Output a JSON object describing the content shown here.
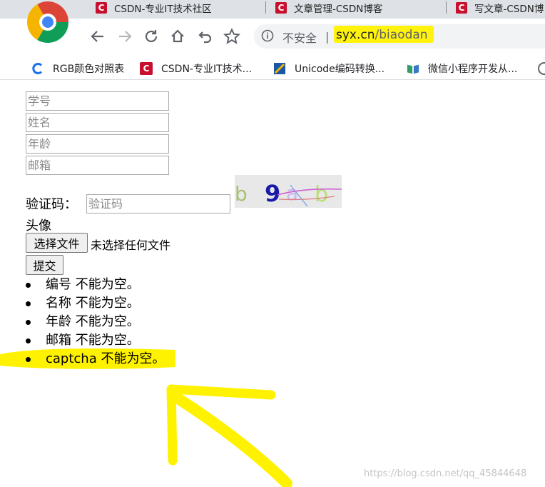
{
  "browser": {
    "tabs": [
      {
        "title": "CSDN-专业IT技术社区"
      },
      {
        "title": "文章管理-CSDN博客"
      },
      {
        "title": "写文章-CSDN博"
      }
    ],
    "omnibox": {
      "security_label": "不安全",
      "divider": "|",
      "url_host": "syx.cn",
      "url_path": "/biaodan"
    },
    "bookmarks": [
      {
        "label": "RGB颜色对照表",
        "icon": "rgb-c-icon"
      },
      {
        "label": "CSDN-专业IT技术...",
        "icon": "csdn-icon"
      },
      {
        "label": "Unicode编码转换...",
        "icon": "unicode-icon"
      },
      {
        "label": "微信小程序开发从...",
        "icon": "book-icon"
      }
    ]
  },
  "form": {
    "fields": [
      {
        "placeholder": "学号",
        "value": ""
      },
      {
        "placeholder": "姓名",
        "value": ""
      },
      {
        "placeholder": "年龄",
        "value": ""
      },
      {
        "placeholder": "邮箱",
        "value": ""
      }
    ],
    "captcha": {
      "label": "验证码：",
      "placeholder": "验证码",
      "value": "",
      "image_text": "b9ab"
    },
    "avatar": {
      "label": "头像",
      "button": "选择文件",
      "status": "未选择任何文件"
    },
    "submit": "提交"
  },
  "errors": [
    "编号 不能为空。",
    "名称 不能为空。",
    "年龄 不能为空。",
    "邮箱 不能为空。",
    "captcha 不能为空。"
  ],
  "watermark": "https://blog.csdn.net/qq_45844648",
  "colors": {
    "annotation": "#fff200",
    "csdn_red": "#c8102e"
  }
}
